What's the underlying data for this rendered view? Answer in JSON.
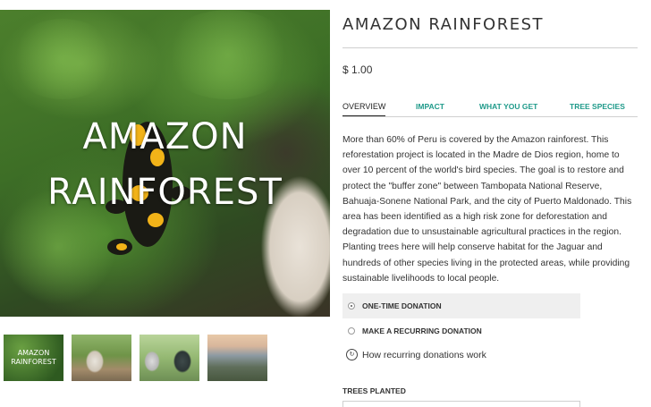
{
  "hero": {
    "title_line1": "AMAZON",
    "title_line2": "RAINFOREST"
  },
  "thumbnails": [
    {
      "label_line1": "AMAZON",
      "label_line2": "RAINFOREST"
    },
    {
      "label_line1": "",
      "label_line2": ""
    },
    {
      "label_line1": "",
      "label_line2": ""
    },
    {
      "label_line1": "",
      "label_line2": ""
    }
  ],
  "product": {
    "title": "AMAZON RAINFOREST",
    "price": "$ 1.00"
  },
  "tabs": [
    {
      "label": "OVERVIEW",
      "active": true
    },
    {
      "label": "IMPACT",
      "active": false
    },
    {
      "label": "WHAT YOU GET",
      "active": false
    },
    {
      "label": "TREE SPECIES",
      "active": false
    }
  ],
  "description": "More than 60% of Peru is covered by the Amazon rainforest. This reforestation project is located in the Madre de Dios region, home to over 10 percent of the world's bird species. The goal is to restore and protect the \"buffer zone\" between Tambopata National Reserve, Bahuaja-Sonene National Park, and the city of Puerto Maldonado. This area has been identified as a high risk zone for deforestation and degradation due to unsustainable agricultural practices in the region. Planting trees here will help conserve habitat for the Jaguar and hundreds of other species living in the protected areas, while providing sustainable livelihoods to local people.",
  "donation": {
    "one_time_label": "ONE-TIME DONATION",
    "recurring_label": "MAKE A RECURRING DONATION",
    "how_label": "How recurring donations work",
    "selected": "one_time"
  },
  "trees_planted": {
    "label": "TREES PLANTED",
    "value": ""
  },
  "colors": {
    "accent_link": "#1f9a8a",
    "selected_option_bg": "#efefef"
  },
  "icons": {
    "how": "recurring-info-icon"
  }
}
